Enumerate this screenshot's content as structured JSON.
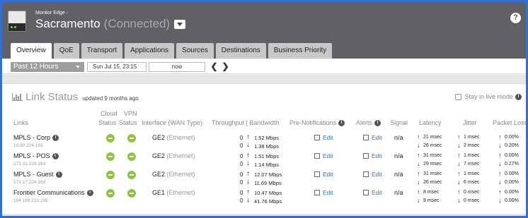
{
  "header": {
    "breadcrumb": "Monitor Edge",
    "breadcrumb_sep": "›",
    "device_name": "Sacramento",
    "status": "(Connected)",
    "help": "?"
  },
  "tabs": [
    "Overview",
    "QoE",
    "Transport",
    "Applications",
    "Sources",
    "Destinations",
    "Business Priority"
  ],
  "active_tab": "Overview",
  "timebar": {
    "period": "Past 12 Hours",
    "from": "Sun Jul 15, 23:15",
    "to": "now",
    "prev": "❮",
    "next": "❯"
  },
  "panel": {
    "title": "Link Status",
    "updated": "updated 9 months ago",
    "live_mode": "Stay in live mode"
  },
  "columns": {
    "links": "Links",
    "cloud_status": "Cloud Status",
    "vpn_status": "VPN Status",
    "cloud_1": "Cloud",
    "cloud_2": "Status",
    "vpn_1": "VPN",
    "vpn_2": "Status",
    "interface": "Interface (WAN Type)",
    "throughput": "Throughput | Bandwidth",
    "pre_notifications": "Pre-Notifications",
    "alerts": "Alerts",
    "signal": "Signal",
    "latency": "Latency",
    "jitter": "Jitter",
    "packet_loss": "Packet Loss"
  },
  "rows": [
    {
      "name": "MPLS - Corp",
      "ip": "10.90.224.163",
      "iface": "GE2",
      "wan": "(Ethernet)",
      "tp_up": "0",
      "tp_down": "0",
      "bw_up": "1.52 Mbps",
      "bw_down": "1.38 Mbps",
      "pre": "Edit",
      "alerts": "Edit",
      "signal": "n/a",
      "lat_up": "21 msec",
      "lat_down": "26 msec",
      "jit_up": "1 msec",
      "jit_down": "2 msec",
      "loss_up": "0.00%",
      "loss_down": "0.20%"
    },
    {
      "name": "MPLS - POS",
      "ip": "172.31.224.163",
      "iface": "GE2",
      "wan": "(Ethernet)",
      "tp_up": "0",
      "tp_down": "0",
      "bw_up": "1.51 Mbps",
      "bw_down": "1.14 Mbps",
      "pre": "Edit",
      "alerts": "Edit",
      "signal": "n/a",
      "lat_up": "31 msec",
      "lat_down": "29 msec",
      "jit_up": "1 msec",
      "jit_down": "7 msec",
      "loss_up": "0.00%",
      "loss_down": "0.27%"
    },
    {
      "name": "MPLS - Guest",
      "ip": "172.17.224.163",
      "iface": "GE2",
      "wan": "(Ethernet)",
      "tp_up": "0",
      "tp_down": "0",
      "bw_up": "12.07 Mbps",
      "bw_down": "11.69 Mbps",
      "pre": "Edit",
      "alerts": "Edit",
      "signal": "n/a",
      "lat_up": "31 msec",
      "lat_down": "26 msec",
      "jit_up": "1 msec",
      "jit_down": "6 msec",
      "loss_up": "0.00%",
      "loss_down": "0.00%"
    },
    {
      "name": "Frontier Communications",
      "ip": "104.169.222.195",
      "iface": "GE1",
      "wan": "(Ethernet)",
      "tp_up": "0",
      "tp_down": "0",
      "bw_up": "10.47 Mbps",
      "bw_down": "41.76 Mbps",
      "pre": "Edit",
      "alerts": "Edit",
      "signal": "n/a",
      "lat_up": "8 msec",
      "lat_down": "9 msec",
      "jit_up": "0 msec",
      "jit_down": "0 msec",
      "loss_up": "0.00%",
      "loss_down": "0.00%"
    }
  ],
  "icons": {
    "device": "edge-device-icon",
    "info": "info-icon",
    "chart": "bar-chart-icon",
    "status_ok": "status-connected-icon",
    "arrow_up": "↑",
    "arrow_down": "↓",
    "info_glyph": "i"
  },
  "colors": {
    "header_bg": "#5f6164",
    "status_green": "#8cc63f",
    "link_blue": "#2e76b8"
  }
}
